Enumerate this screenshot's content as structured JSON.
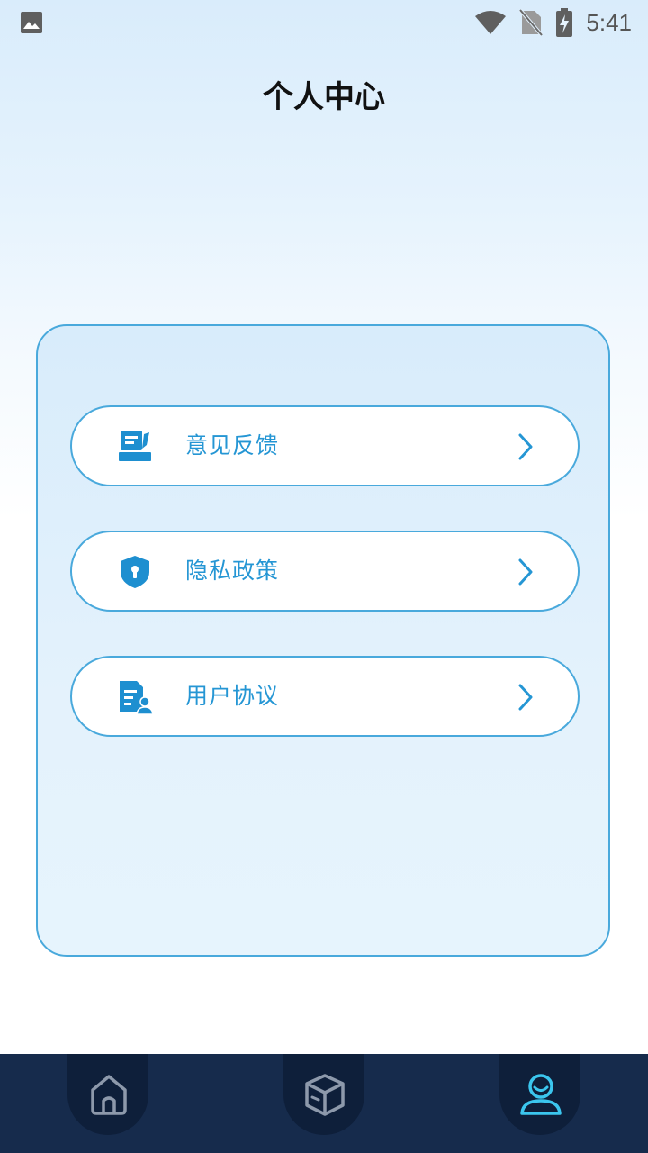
{
  "status_bar": {
    "time": "5:41",
    "icons": [
      "image-icon",
      "wifi-icon",
      "no-sim-icon",
      "battery-charging-icon"
    ]
  },
  "header": {
    "title": "个人中心"
  },
  "menu": {
    "items": [
      {
        "label": "意见反馈",
        "icon": "feedback-icon"
      },
      {
        "label": "隐私政策",
        "icon": "shield-lock-icon"
      },
      {
        "label": "用户协议",
        "icon": "user-agreement-icon"
      }
    ]
  },
  "tab_bar": {
    "tabs": [
      {
        "icon": "home-icon",
        "active": false
      },
      {
        "icon": "box-icon",
        "active": false
      },
      {
        "icon": "profile-icon",
        "active": true
      }
    ],
    "colors": {
      "inactive": "#8d99ab",
      "active": "#3bc6ee"
    }
  },
  "colors": {
    "accent": "#2596d4",
    "border": "#49a9dc",
    "tab_bar_bg": "#162b4c"
  }
}
